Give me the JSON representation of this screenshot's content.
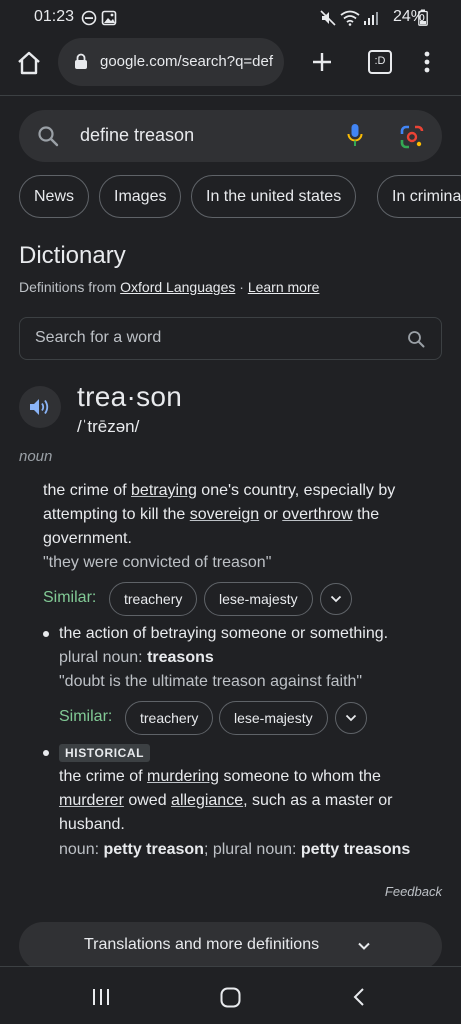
{
  "status_bar": {
    "time": "01:23",
    "battery": "24%",
    "icons": [
      "dnd-icon",
      "gallery-icon",
      "mute-icon",
      "wifi-icon",
      "signal-icon",
      "battery-icon"
    ]
  },
  "browser": {
    "url": "google.com/search?q=def",
    "tab_count": ":D",
    "icons": [
      "home-icon",
      "lock-icon",
      "new-tab-icon",
      "tabs-icon",
      "menu-icon"
    ]
  },
  "search": {
    "query": "define treason",
    "icons": [
      "search-icon",
      "mic-icon",
      "lens-icon"
    ]
  },
  "chips": [
    "News",
    "Images",
    "In the united states",
    "In criminal"
  ],
  "dictionary": {
    "title": "Dictionary",
    "source_prefix": "Definitions from ",
    "source_name": "Oxford Languages",
    "separator": " · ",
    "learn_more": "Learn more",
    "word_search_placeholder": "Search for a word"
  },
  "entry": {
    "word": "trea·son",
    "pronunciation": "/ˈtrēzən/",
    "part_of_speech": "noun",
    "definitions": [
      {
        "text_parts": [
          {
            "t": "the crime of ",
            "u": false
          },
          {
            "t": "betraying",
            "u": true
          },
          {
            "t": " one's country, especially by attempting to kill the ",
            "u": false
          },
          {
            "t": "sovereign",
            "u": true
          },
          {
            "t": " or ",
            "u": false
          },
          {
            "t": "overthrow",
            "u": true
          },
          {
            "t": " the government.",
            "u": false
          }
        ],
        "example": "\"they were convicted of treason\"",
        "similar_label": "Similar:",
        "similar": [
          "treachery",
          "lese-majesty"
        ]
      },
      {
        "text": "the action of betraying someone or something.",
        "plural_label": "plural noun: ",
        "plural": "treasons",
        "example": "\"doubt is the ultimate treason against faith\"",
        "similar_label": "Similar:",
        "similar": [
          "treachery",
          "lese-majesty"
        ]
      },
      {
        "badge": "HISTORICAL",
        "text_parts": [
          {
            "t": "the crime of ",
            "u": false
          },
          {
            "t": "murdering",
            "u": true
          },
          {
            "t": " someone to whom the ",
            "u": false
          },
          {
            "t": "murderer",
            "u": true
          },
          {
            "t": " owed ",
            "u": false
          },
          {
            "t": "allegiance",
            "u": true
          },
          {
            "t": ", such as a master or husband.",
            "u": false
          }
        ],
        "noun_label": "noun: ",
        "noun": "petty treason",
        "sep": "; ",
        "plural_label": "plural noun: ",
        "plural": "petty treasons"
      }
    ]
  },
  "feedback": "Feedback",
  "more_button": "Translations and more definitions",
  "colors": {
    "background": "#202124",
    "surface": "#303134",
    "similar_green": "#81c995",
    "mic_blue": "#4285f4",
    "mic_yellow": "#fbbc04"
  }
}
